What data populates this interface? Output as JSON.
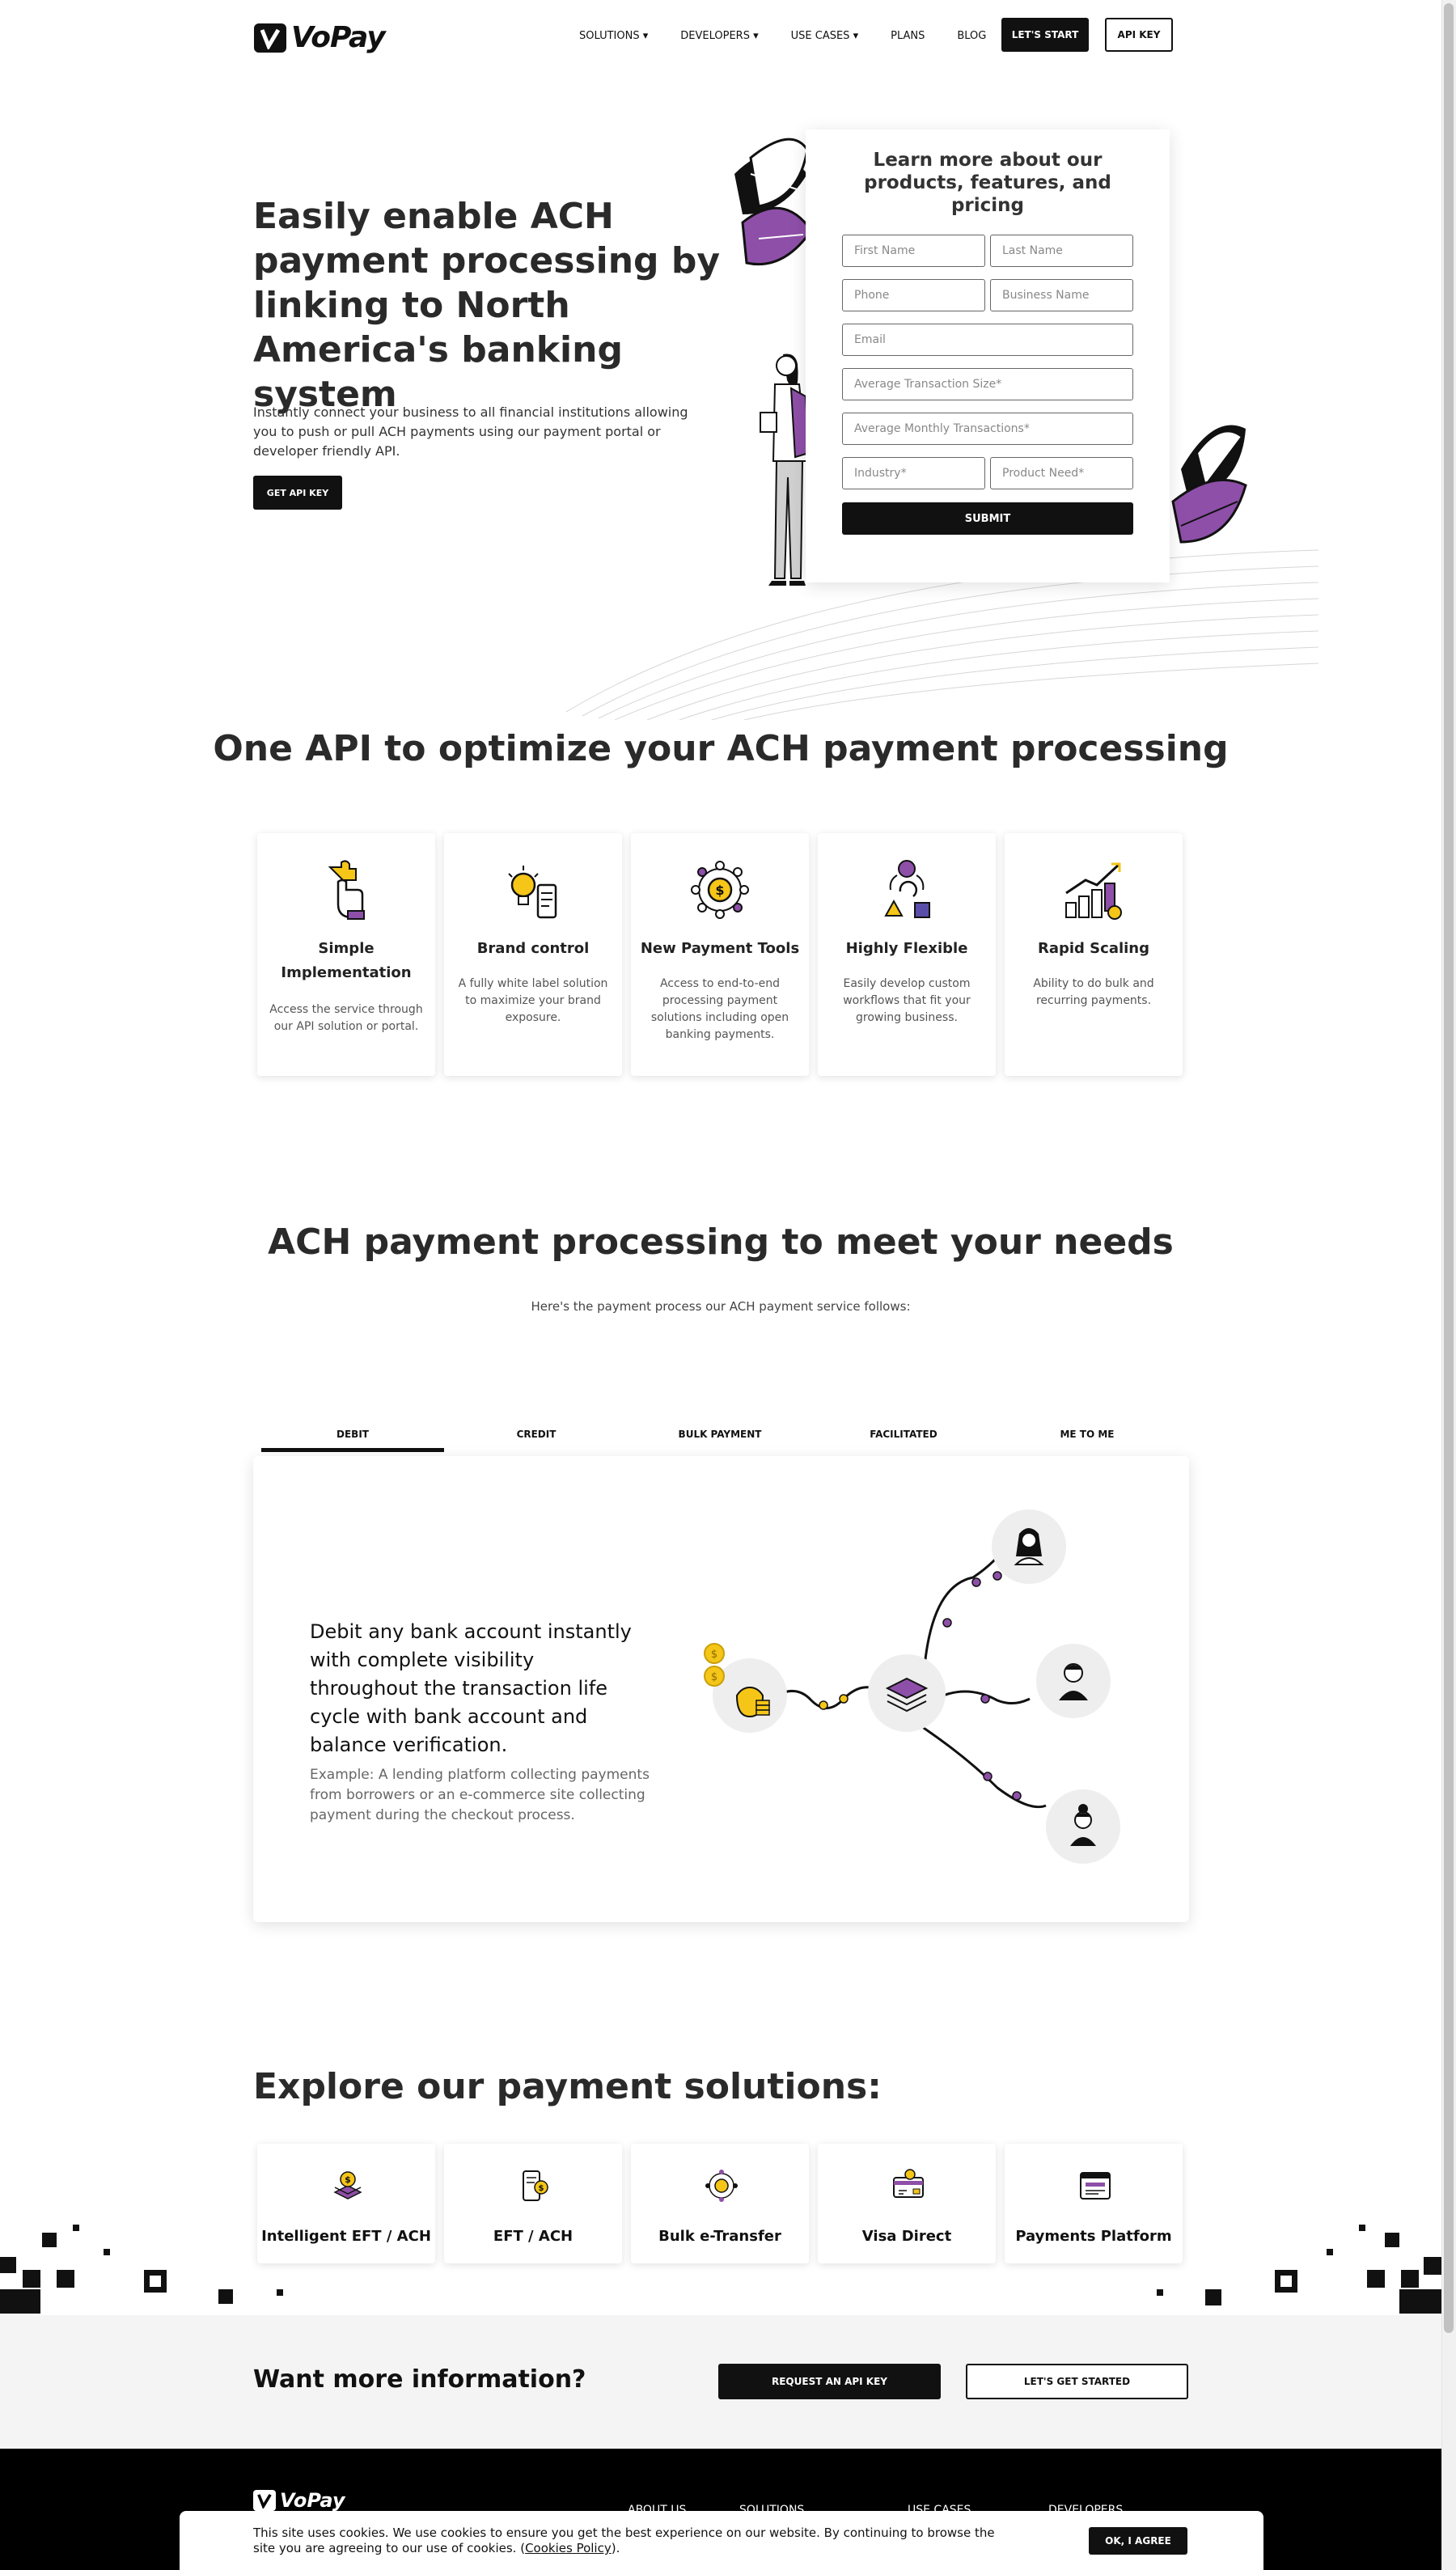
{
  "brand": {
    "name": "VoPay"
  },
  "nav": {
    "items": [
      "SOLUTIONS",
      "DEVELOPERS",
      "USE CASES",
      "PLANS",
      "BLOG"
    ],
    "lets_start": "LET'S START",
    "api_key": "API KEY"
  },
  "hero": {
    "title": "Easily enable ACH payment processing by linking to North America's banking system",
    "description": "Instantly connect your business to all financial institutions allowing you to push or pull ACH payments using our payment portal or developer friendly API.",
    "cta": "GET API KEY"
  },
  "form": {
    "title": "Learn more about our products, features, and pricing",
    "first_name": "First Name",
    "last_name": "Last Name",
    "phone": "Phone",
    "business_name": "Business Name",
    "email": "Email",
    "avg_transaction": "Average Transaction Size*",
    "avg_monthly": "Average Monthly Transactions*",
    "industry": "Industry*",
    "product_need": "Product Need*",
    "submit": "SUBMIT"
  },
  "features": {
    "heading": "One API to optimize your ACH payment processing",
    "cards": [
      {
        "title": "Simple Implementation",
        "desc": "Access the service through our API solution or portal."
      },
      {
        "title": "Brand control",
        "desc": "A fully white label solution to maximize your brand exposure."
      },
      {
        "title": "New Payment Tools",
        "desc": "Access to end-to-end processing payment solutions including open banking payments."
      },
      {
        "title": "Highly Flexible",
        "desc": "Easily develop custom workflows that fit your growing business."
      },
      {
        "title": "Rapid Scaling",
        "desc": "Ability to do bulk and recurring payments."
      }
    ]
  },
  "process": {
    "heading": "ACH payment processing to meet your needs",
    "subheading": "Here's the payment process our ACH payment service follows:",
    "tabs": [
      "DEBIT",
      "CREDIT",
      "BULK PAYMENT",
      "FACILITATED",
      "ME TO ME"
    ],
    "active_tab": "DEBIT",
    "panel_title": "Debit any bank account instantly with complete visibility throughout the transaction life cycle with bank account and balance verification.",
    "panel_example": "Example: A lending platform collecting payments from borrowers or an e-commerce site collecting payment during the checkout process."
  },
  "solutions": {
    "heading": "Explore our payment solutions:",
    "items": [
      "Intelligent EFT / ACH",
      "EFT / ACH",
      "Bulk e-Transfer",
      "Visa Direct",
      "Payments Platform"
    ]
  },
  "cta": {
    "heading": "Want more information?",
    "request": "REQUEST AN API KEY",
    "started": "LET'S GET STARTED"
  },
  "footer": {
    "columns": [
      "ABOUT US",
      "SOLUTIONS",
      "USE CASES",
      "DEVELOPERS"
    ]
  },
  "cookie": {
    "text": "This site uses cookies. We use cookies to ensure you get the best experience on our website. By continuing to browse the site you are agreeing to our use of cookies.",
    "policy_link": "Cookies Policy",
    "accept": "OK, I AGREE"
  },
  "colors": {
    "accent": "#8e4fa8",
    "yellow": "#f5c518",
    "dark": "#111111"
  }
}
